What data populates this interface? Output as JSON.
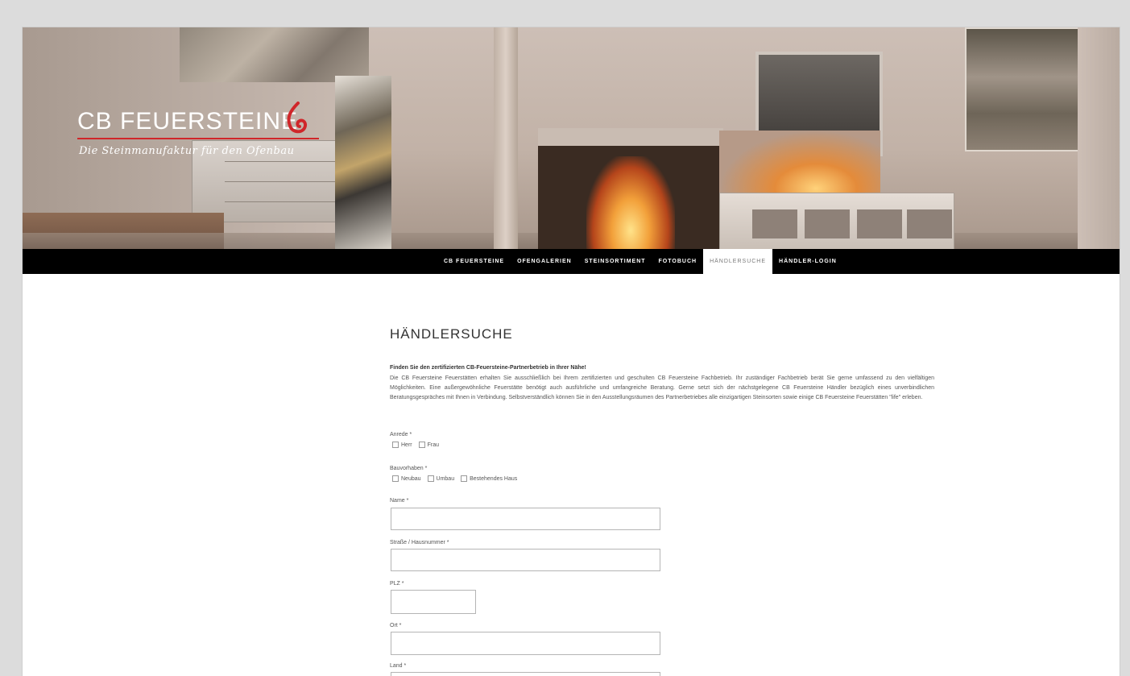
{
  "brand": {
    "title": "CB FEUERSTEINE",
    "subtitle": "Die Steinmanufaktur für den Ofenbau",
    "accent": "#d0262a"
  },
  "nav": {
    "items": [
      {
        "label": "CB FEUERSTEINE",
        "active": false
      },
      {
        "label": "OFENGALERIEN",
        "active": false
      },
      {
        "label": "STEINSORTIMENT",
        "active": false
      },
      {
        "label": "FOTOBUCH",
        "active": false
      },
      {
        "label": "HÄNDLERSUCHE",
        "active": true
      },
      {
        "label": "HÄNDLER-LOGIN",
        "active": false
      }
    ]
  },
  "page": {
    "title": "HÄNDLERSUCHE",
    "intro_heading": "Finden Sie den zertifizierten CB-Feuersteine-Partnerbetrieb in Ihrer Nähe!",
    "intro_text": "Die CB Feuersteine Feuerstätten erhalten Sie ausschließlich bei Ihrem zertifizierten und geschulten CB Feuersteine Fachbetrieb. Ihr zuständiger Fachbetrieb berät Sie gerne umfassend zu den vielfältigen Möglichkeiten. Eine außergewöhnliche Feuerstätte benötigt auch ausführliche und umfangreiche Beratung. Gerne setzt sich der nächstgelegene CB Feuersteine Händler bezüglich eines unverbindlichen Beratungsgespräches mit Ihnen in Verbindung. Selbstverständlich können Sie in den Ausstellungsräumen des Partnerbetriebes alle einzigartigen Steinsorten sowie einige CB Feuersteine Feuerstätten \"life\" erleben."
  },
  "form": {
    "anrede": {
      "label": "Anrede *",
      "options": [
        "Herr",
        "Frau"
      ]
    },
    "bauvorhaben": {
      "label": "Bauvorhaben *",
      "options": [
        "Neubau",
        "Umbau",
        "Bestehendes Haus"
      ]
    },
    "name": {
      "label": "Name *",
      "value": ""
    },
    "strasse": {
      "label": "Straße / Hausnummer *",
      "value": ""
    },
    "plz": {
      "label": "PLZ *",
      "value": ""
    },
    "ort": {
      "label": "Ort *",
      "value": ""
    },
    "land": {
      "label": "Land *",
      "value": ""
    }
  }
}
